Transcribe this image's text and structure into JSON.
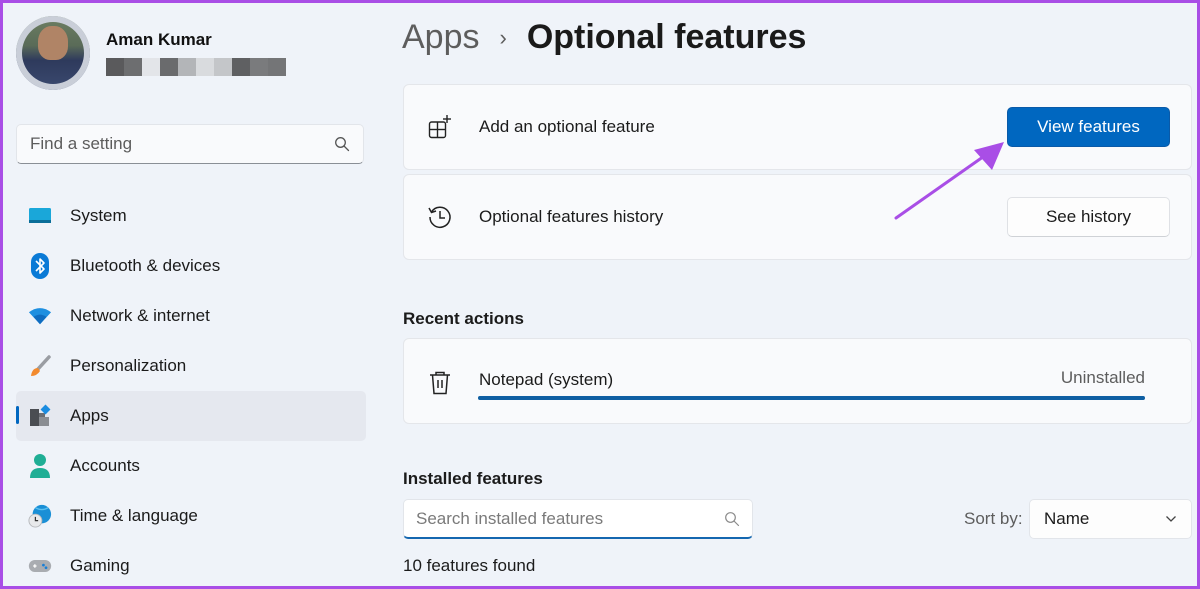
{
  "profile": {
    "name": "Aman Kumar",
    "email_redacted_colors": [
      "#5a5a5c",
      "#6d6e70",
      "#e3e5e9",
      "#6a6b6d",
      "#b3b5b8",
      "#d9dbde",
      "#c4c6c9",
      "#5f6062",
      "#7a7b7d",
      "#747577"
    ]
  },
  "sidebar": {
    "search_placeholder": "Find a setting",
    "items": [
      {
        "label": "System",
        "icon": "system-icon",
        "active": false
      },
      {
        "label": "Bluetooth & devices",
        "icon": "bluetooth-icon",
        "active": false
      },
      {
        "label": "Network & internet",
        "icon": "wifi-icon",
        "active": false
      },
      {
        "label": "Personalization",
        "icon": "paintbrush-icon",
        "active": false
      },
      {
        "label": "Apps",
        "icon": "apps-icon",
        "active": true
      },
      {
        "label": "Accounts",
        "icon": "person-icon",
        "active": false
      },
      {
        "label": "Time & language",
        "icon": "globe-clock-icon",
        "active": false
      },
      {
        "label": "Gaming",
        "icon": "gamepad-icon",
        "active": false
      }
    ]
  },
  "header": {
    "parent": "Apps",
    "separator": "›",
    "current": "Optional features"
  },
  "cards": {
    "add": {
      "label": "Add an optional feature",
      "button": "View features"
    },
    "history": {
      "label": "Optional features history",
      "button": "See history"
    }
  },
  "recent": {
    "title": "Recent actions",
    "items": [
      {
        "name": "Notepad (system)",
        "status": "Uninstalled",
        "progress": 1.0
      }
    ]
  },
  "installed": {
    "title": "Installed features",
    "search_placeholder": "Search installed features",
    "sort_label": "Sort by:",
    "sort_value": "Name",
    "count_text": "10 features found"
  },
  "colors": {
    "accent": "#0067c0",
    "annotation": "#a94ee6",
    "progress": "#0f5fa3"
  }
}
